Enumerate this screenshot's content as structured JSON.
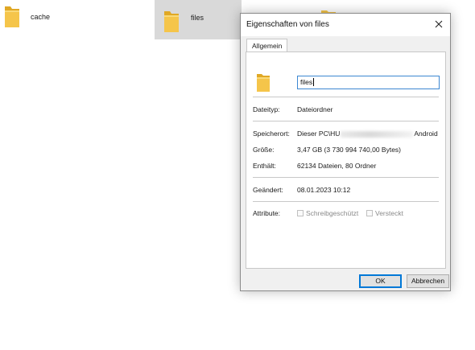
{
  "explorer": {
    "items": [
      {
        "name": "cache",
        "selected": false
      },
      {
        "name": "files",
        "selected": true
      }
    ]
  },
  "dialog": {
    "title": "Eigenschaften von files",
    "tabs": [
      {
        "label": "Allgemein",
        "active": true
      }
    ],
    "name_value": "files",
    "rows": {
      "type": {
        "label": "Dateityp:",
        "value": "Dateiordner"
      },
      "location": {
        "label": "Speicherort:",
        "value_prefix": "Dieser PC\\HU",
        "value_suffix": "Android"
      },
      "size": {
        "label": "Größe:",
        "value": "3,47 GB (3 730 994 740,00 Bytes)"
      },
      "contains": {
        "label": "Enthält:",
        "value": "62134 Dateien, 80 Ordner"
      },
      "modified": {
        "label": "Geändert:",
        "value": "08.01.2023 10:12"
      },
      "attributes": {
        "label": "Attribute:"
      }
    },
    "attributes": {
      "readonly": {
        "label": "Schreibgeschützt",
        "checked": false,
        "enabled": false
      },
      "hidden": {
        "label": "Versteckt",
        "checked": false,
        "enabled": false
      }
    },
    "buttons": {
      "ok": "OK",
      "cancel": "Abbrechen"
    }
  },
  "colors": {
    "folder": "#f5c54a",
    "folder_dark": "#e0a825",
    "selection": "#d9d9d9",
    "accent": "#0078d7"
  }
}
